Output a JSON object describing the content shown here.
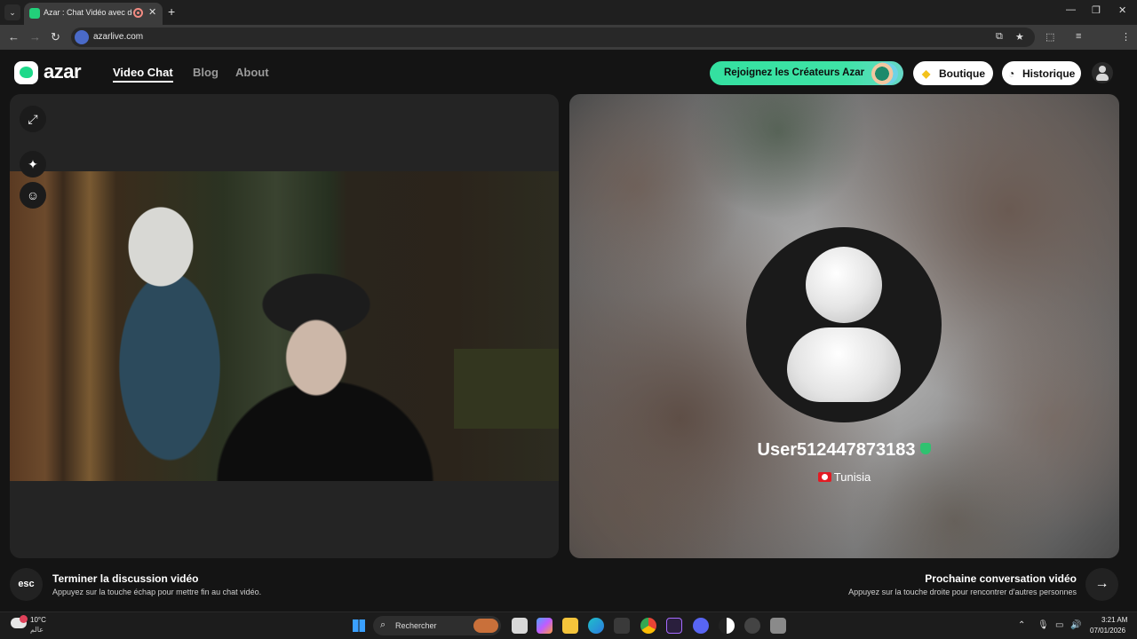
{
  "browser": {
    "tab_title": "Azar : Chat Vidéo avec de n",
    "url": "azarlive.com"
  },
  "header": {
    "logo": "azar",
    "nav": [
      "Video Chat",
      "Blog",
      "About"
    ],
    "creators_button": "Rejoignez les Créateurs Azar",
    "shop_button": "Boutique",
    "history_button": "Historique"
  },
  "partner": {
    "username": "User512447873183",
    "country": "Tunisia"
  },
  "actions": {
    "end": {
      "key": "esc",
      "title": "Terminer la discussion vidéo",
      "desc": "Appuyez sur la touche échap pour mettre fin au chat vidéo."
    },
    "next": {
      "title": "Prochaine conversation vidéo",
      "desc": "Appuyez sur la touche droite pour rencontrer d'autres personnes"
    }
  },
  "taskbar": {
    "temperature": "10°C",
    "location": "عالم",
    "search_placeholder": "Rechercher",
    "time": "3:21 AM",
    "date": "07/01/2026"
  },
  "colors": {
    "accent": "#34e0a0",
    "background": "#141414",
    "panel": "#242424"
  },
  "icons": [
    "expand-icon",
    "sparkle-icon",
    "face-filter-icon",
    "gem-icon",
    "clock-icon",
    "arrow-right-icon",
    "search-icon"
  ]
}
